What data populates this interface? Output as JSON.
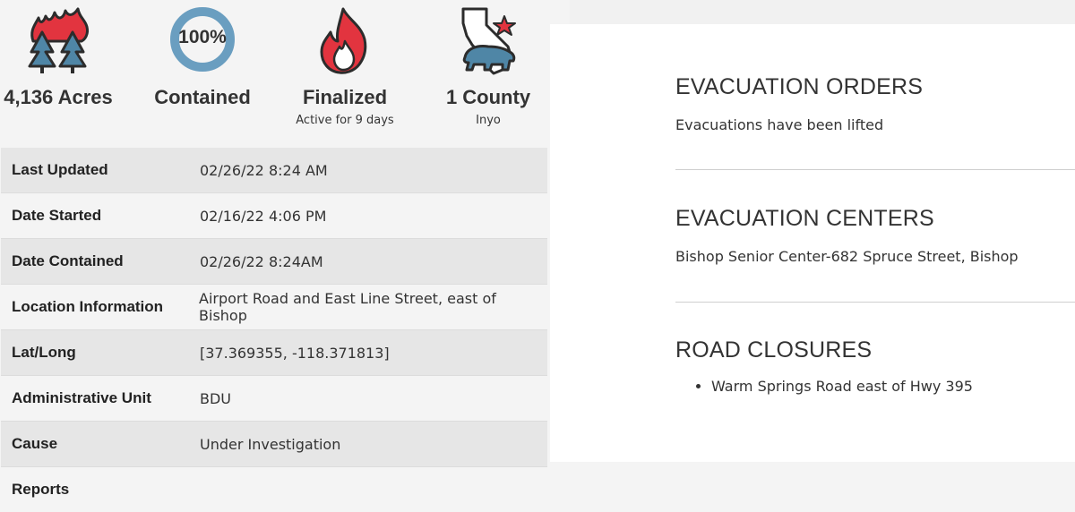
{
  "stats": [
    {
      "value": "4,136 Acres",
      "sub": "",
      "icon": "burning-trees-icon"
    },
    {
      "value": "Contained",
      "sub": "",
      "ring_label": "100%",
      "icon": "containment-ring-icon",
      "percent": 100
    },
    {
      "value": "Finalized",
      "sub": "Active for 9 days",
      "icon": "flame-icon"
    },
    {
      "value": "1 County",
      "sub": "Inyo",
      "icon": "california-bear-icon"
    }
  ],
  "details": [
    {
      "key": "Last Updated",
      "value": "02/26/22 8:24 AM"
    },
    {
      "key": "Date Started",
      "value": "02/16/22 4:06 PM"
    },
    {
      "key": "Date Contained",
      "value": "02/26/22 8:24AM"
    },
    {
      "key": "Location Information",
      "value": "Airport Road and East Line Street, east of Bishop"
    },
    {
      "key": "Lat/Long",
      "value": "[37.369355, -118.371813]"
    },
    {
      "key": "Administrative Unit",
      "value": "BDU"
    },
    {
      "key": "Cause",
      "value": "Under Investigation"
    },
    {
      "key": "Reports",
      "value": ""
    }
  ],
  "evacuation_orders": {
    "title": "EVACUATION ORDERS",
    "text": "Evacuations have been lifted"
  },
  "evacuation_centers": {
    "title": "EVACUATION CENTERS",
    "text": "Bishop Senior Center-682 Spruce Street, Bishop"
  },
  "road_closures": {
    "title": "ROAD CLOSURES",
    "items": [
      "Warm Springs Road east of Hwy 395"
    ]
  },
  "colors": {
    "flame_red": "#e2343f",
    "tree_blue": "#4f86a6",
    "ring_blue": "#6a9ec0",
    "outline": "#2c2c2c"
  }
}
